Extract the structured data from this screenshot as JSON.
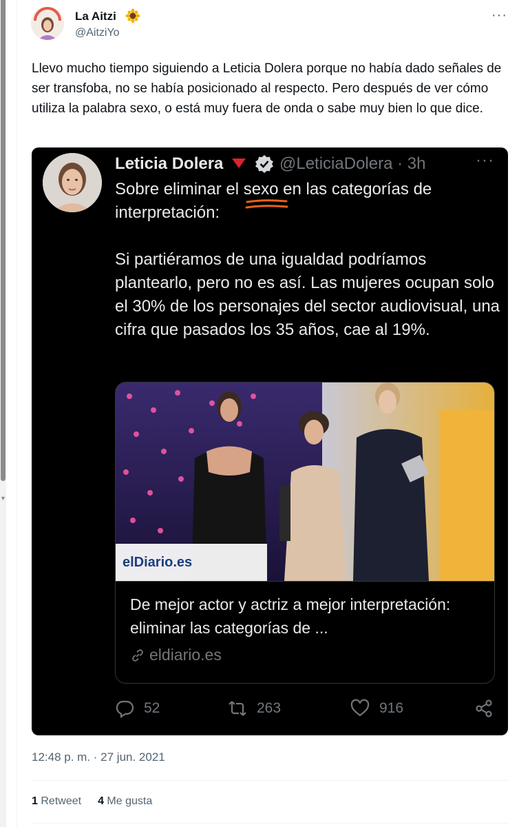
{
  "tweet": {
    "author_name": "La Aitzi",
    "author_handle": "@AitziYo",
    "text": "Llevo mucho tiempo siguiendo a Leticia Dolera porque no había dado señales de ser transfoba, no se había posicionado al respecto. Pero después de ver cómo utiliza la palabra sexo, o está muy fuera de onda o sabe muy bien lo que dice.",
    "timestamp": "12:48 p. m. · 27 jun. 2021",
    "retweets_count": "1",
    "retweets_label": "Retweet",
    "likes_count": "4",
    "likes_label": "Me gusta"
  },
  "quoted": {
    "author_name": "Leticia Dolera",
    "handle_time": "@LeticiaDolera · 3h",
    "text_before": "Sobre eliminar el ",
    "text_highlight": "sexo",
    "text_after": " en las categorías de interpretación:\n\nSi partiéramos de una igualdad podríamos plantearlo, pero no es así. Las mujeres ocupan solo el 30% de los personajes del sector audiovisual, una cifra que pasados los 35 años, cae al 19%.",
    "link_card": {
      "image_logo": "elDiario.es",
      "title": "De mejor actor y actriz a mejor interpretación: eliminar las categorías de ...",
      "domain": "eldiario.es"
    },
    "replies": "52",
    "retweets": "263",
    "likes": "916"
  },
  "colors": {
    "quote_background": "#000000",
    "underline_annotation": "#e8611a",
    "flag_red": "#d9232e"
  }
}
